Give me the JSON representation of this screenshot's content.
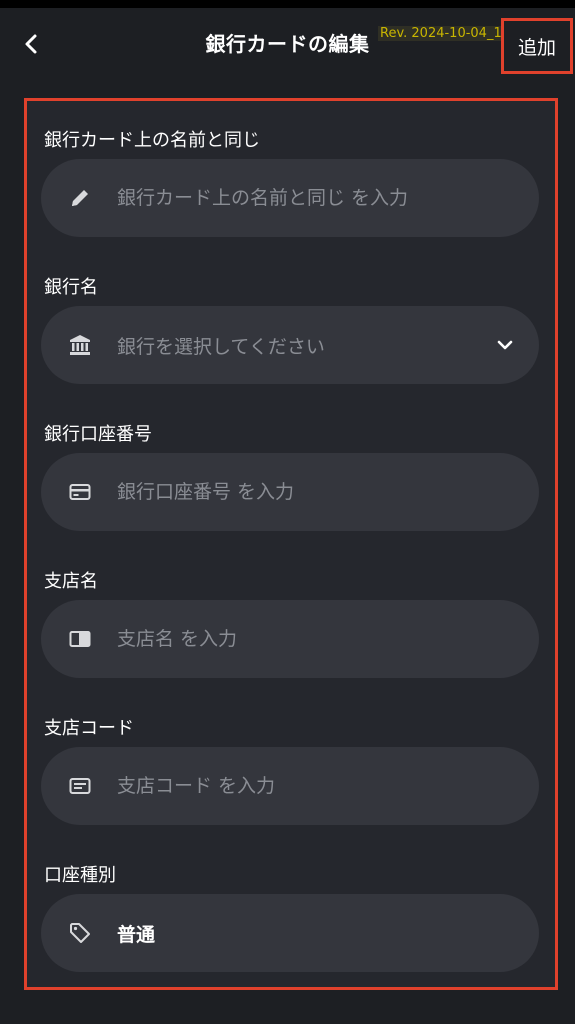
{
  "header": {
    "title": "銀行カードの編集",
    "rev": "Rev. 2024-10-04_1",
    "add_label": "追加"
  },
  "form": {
    "fields": [
      {
        "label": "銀行カード上の名前と同じ",
        "placeholder": "銀行カード上の名前と同じ を入力",
        "icon": "pencil-icon"
      },
      {
        "label": "銀行名",
        "placeholder": "銀行を選択してください",
        "icon": "bank-icon"
      },
      {
        "label": "銀行口座番号",
        "placeholder": "銀行口座番号 を入力",
        "icon": "card-icon"
      },
      {
        "label": "支店名",
        "placeholder": "支店名 を入力",
        "icon": "book-icon"
      },
      {
        "label": "支店コード",
        "placeholder": "支店コード を入力",
        "icon": "id-card-icon"
      },
      {
        "label": "口座種別",
        "value": "普通",
        "icon": "tag-icon"
      }
    ]
  },
  "colors": {
    "background": "#1d1f23",
    "panel": "#25272d",
    "input": "#34363d",
    "highlight": "#e0412c",
    "placeholder": "#8a8d94"
  }
}
